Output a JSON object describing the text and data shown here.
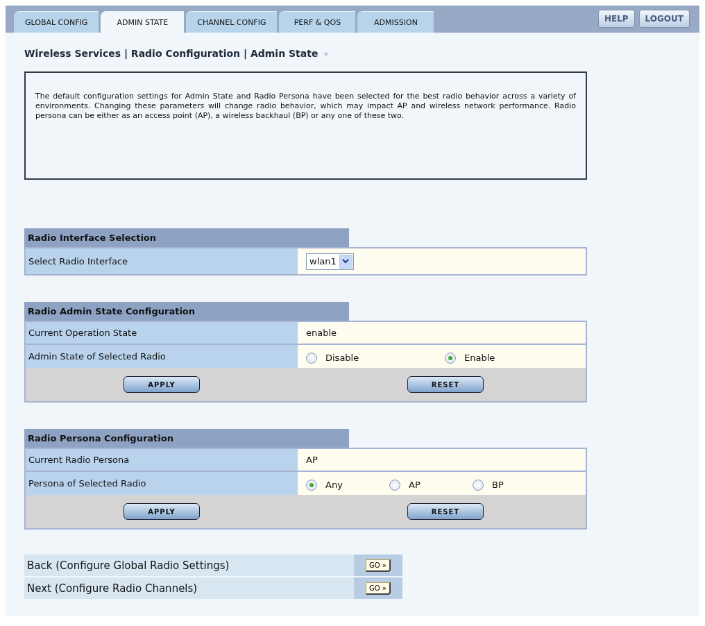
{
  "tabs": [
    {
      "label": "GLOBAL CONFIG",
      "selected": false
    },
    {
      "label": "ADMIN STATE",
      "selected": true
    },
    {
      "label": "CHANNEL CONFIG",
      "selected": false
    },
    {
      "label": "PERF & QOS",
      "selected": false
    },
    {
      "label": "ADMISSION",
      "selected": false
    }
  ],
  "top_buttons": [
    "HELP",
    "LOGOUT"
  ],
  "breadcrumb": {
    "text": "Wireless Services | Radio Configuration | Admin State",
    "marker": "»"
  },
  "description": "The default configuration settings for Admin State and Radio Persona have been selected for the best radio behavior across a variety of environments. Changing these parameters will change radio behavior, which may impact AP and wireless network performance. Radio persona can be either as an access point (AP), a wireless backhaul (BP) or any one of these two.",
  "sections": [
    {
      "title": "Radio Interface Selection",
      "rows": [
        {
          "kind": "select",
          "label": "Select Radio Interface",
          "value": "wlan1"
        }
      ]
    },
    {
      "title": "Radio Admin State Configuration",
      "rows": [
        {
          "kind": "text",
          "label": "Current Operation State",
          "value": "enable"
        },
        {
          "kind": "radio",
          "label": "Admin State of Selected Radio",
          "options": [
            {
              "label": "Disable",
              "selected": false
            },
            {
              "label": "Enable",
              "selected": true
            }
          ]
        }
      ],
      "buttons": [
        "APPLY",
        "RESET"
      ]
    },
    {
      "title": "Radio Persona Configuration",
      "rows": [
        {
          "kind": "text",
          "label": "Current Radio Persona",
          "value": "AP"
        },
        {
          "kind": "radio",
          "label": "Persona of Selected Radio",
          "options": [
            {
              "label": "Any",
              "selected": true
            },
            {
              "label": "AP",
              "selected": false
            },
            {
              "label": "BP",
              "selected": false
            }
          ]
        }
      ],
      "buttons": [
        "APPLY",
        "RESET"
      ]
    }
  ],
  "nav_links": [
    {
      "label": "Back (Configure Global Radio Settings)",
      "button": "GO »"
    },
    {
      "label": "Next (Configure Radio Channels)",
      "button": "GO »"
    }
  ]
}
